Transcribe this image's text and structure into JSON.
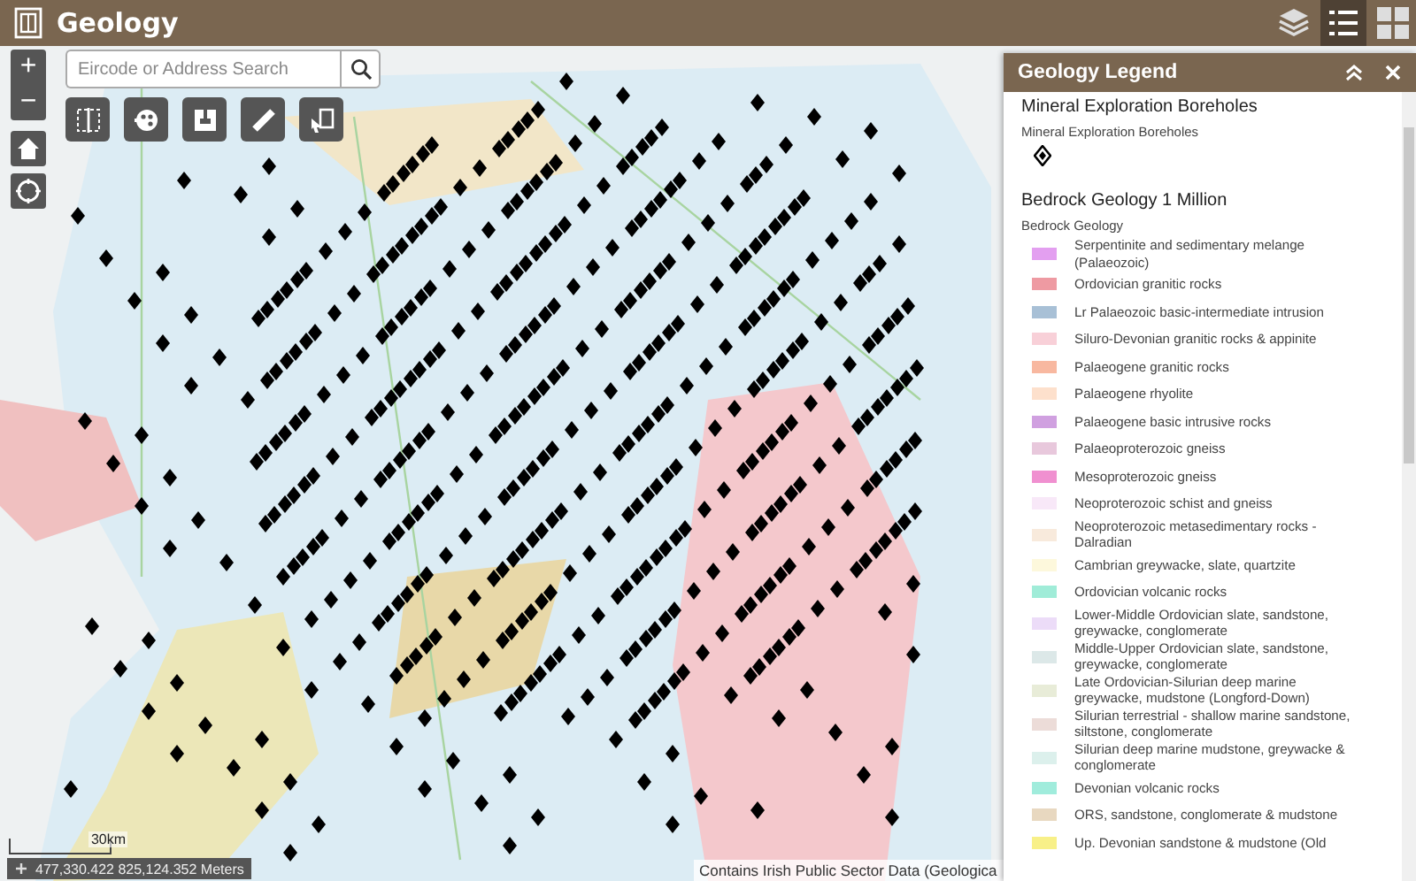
{
  "header": {
    "title": "Geology",
    "widgets": [
      {
        "kind": "layers",
        "selected": false
      },
      {
        "kind": "legend",
        "selected": true
      },
      {
        "kind": "grid",
        "selected": false
      }
    ]
  },
  "search": {
    "placeholder": "Eircode or Address Search"
  },
  "map_controls": {
    "zoom_in": "+",
    "zoom_out": "−"
  },
  "tools": [
    {
      "kind": "split"
    },
    {
      "kind": "palette"
    },
    {
      "kind": "print"
    },
    {
      "kind": "measure"
    },
    {
      "kind": "select"
    }
  ],
  "legend": {
    "title": "Geology Legend",
    "sections": [
      {
        "title": "Mineral Exploration Boreholes",
        "layer": "Mineral Exploration Boreholes",
        "kind": "symbol"
      },
      {
        "title": "Bedrock Geology 1 Million",
        "layer": "Bedrock Geology",
        "kind": "swatches",
        "items": [
          {
            "label": "Serpentinite and sedimentary melange (Palaeozoic)",
            "color": "#e39ff0"
          },
          {
            "label": "Ordovician granitic rocks",
            "color": "#ee9aa2"
          },
          {
            "label": "Lr Palaeozoic basic-intermediate intrusion",
            "color": "#a8c0d6"
          },
          {
            "label": "Siluro-Devonian granitic rocks & appinite",
            "color": "#f8d0d8"
          },
          {
            "label": "Palaeogene granitic rocks",
            "color": "#f8b8a0"
          },
          {
            "label": "Palaeogene rhyolite",
            "color": "#fde0cc"
          },
          {
            "label": "Palaeogene basic intrusive rocks",
            "color": "#d0a0e0"
          },
          {
            "label": "Palaeoproterozoic gneiss",
            "color": "#e8c8dc"
          },
          {
            "label": "Mesoproterozoic gneiss",
            "color": "#f090d0"
          },
          {
            "label": "Neoproterozoic schist and gneiss",
            "color": "#f8e8f8"
          },
          {
            "label": "Neoproterozoic metasedimentary rocks - Dalradian",
            "color": "#f8eadc"
          },
          {
            "label": "Cambrian greywacke, slate, quartzite",
            "color": "#fdf8dc"
          },
          {
            "label": "Ordovician volcanic rocks",
            "color": "#a0ecd8"
          },
          {
            "label": "Lower-Middle Ordovician slate, sandstone, greywacke, conglomerate",
            "color": "#ecdcf8"
          },
          {
            "label": "Middle-Upper Ordovician slate, sandstone, greywacke, conglomerate",
            "color": "#dce8e8"
          },
          {
            "label": "Late Ordovician-Silurian deep marine greywacke, mudstone (Longford-Down)",
            "color": "#e8ecd8"
          },
          {
            "label": "Silurian terrestrial - shallow marine sandstone, siltstone, conglomerate",
            "color": "#ecdcd8"
          },
          {
            "label": "Silurian deep marine mudstone, greywacke & conglomerate",
            "color": "#dcf0ec"
          },
          {
            "label": "Devonian volcanic rocks",
            "color": "#a0ecdc"
          },
          {
            "label": "ORS, sandstone, conglomerate & mudstone",
            "color": "#e8d8c0"
          },
          {
            "label": "Up. Devonian sandstone & mudstone (Old",
            "color": "#f8f088"
          }
        ]
      }
    ]
  },
  "status": {
    "scale": "30km",
    "coordinates": "477,330.422 825,124.352 Meters",
    "attribution": "Contains Irish Public Sector Data (Geologica"
  }
}
